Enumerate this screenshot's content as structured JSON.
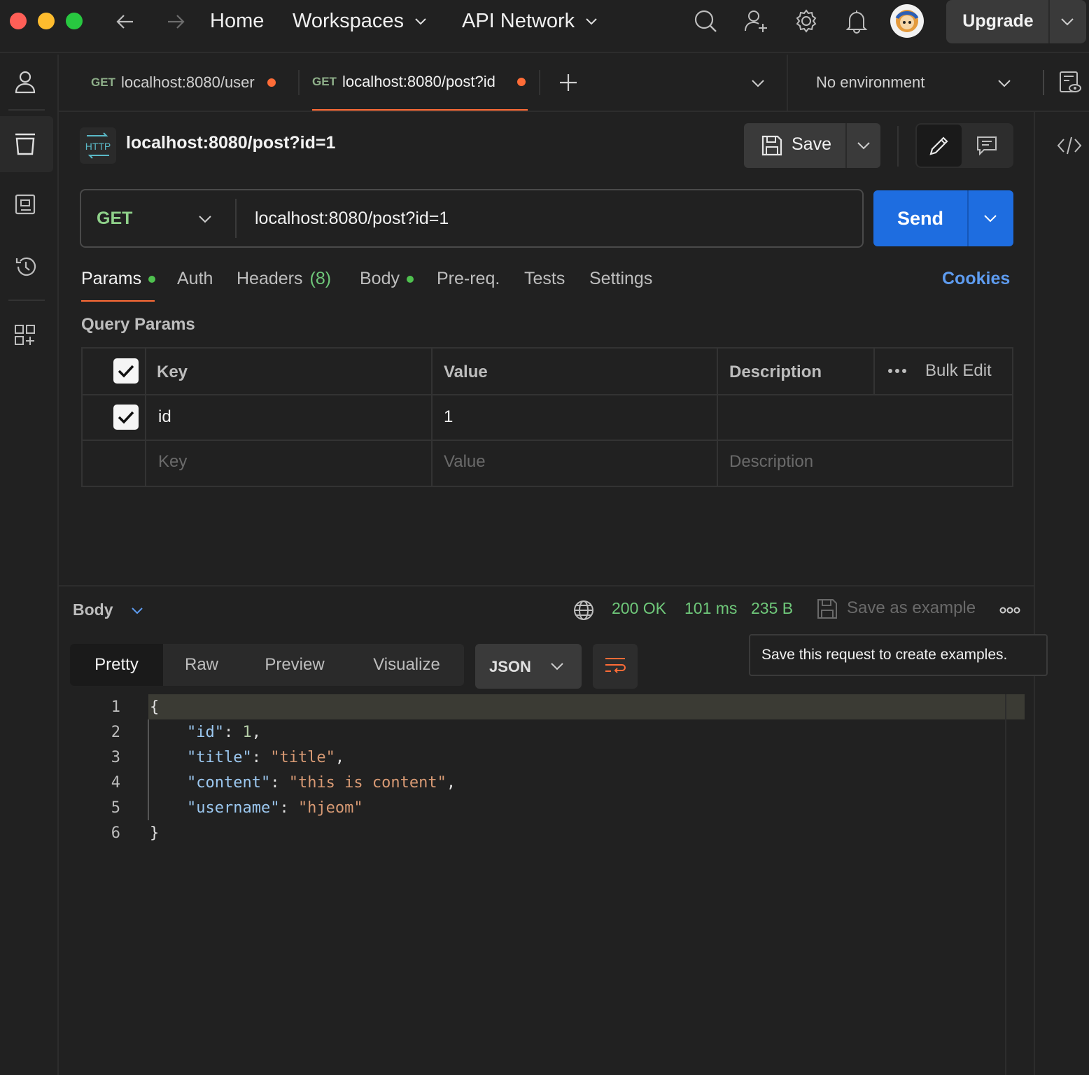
{
  "topbar": {
    "nav": {
      "home": "Home",
      "workspaces": "Workspaces",
      "api_network": "API Network"
    },
    "upgrade_label": "Upgrade",
    "icons": [
      "back-arrow-icon",
      "forward-arrow-icon",
      "search-icon",
      "invite-user-icon",
      "settings-gear-icon",
      "notification-bell-icon",
      "avatar",
      "chevron-down-icon"
    ]
  },
  "sidebar": {
    "items": [
      "user-icon",
      "collections-icon",
      "environments-icon",
      "history-icon",
      "add-apps-icon"
    ],
    "active": "collections-icon"
  },
  "tabs": {
    "items": [
      {
        "method": "GET",
        "label": "localhost:8080/user",
        "unsaved": true
      },
      {
        "method": "GET",
        "label": "localhost:8080/post?id",
        "unsaved": true,
        "active": true
      }
    ],
    "environment": "No environment"
  },
  "request": {
    "badge": "HTTP",
    "title": "localhost:8080/post?id=1",
    "save_label": "Save",
    "method": "GET",
    "url": "localhost:8080/post?id=1",
    "send_label": "Send"
  },
  "request_tabs": {
    "params": "Params",
    "auth": "Auth",
    "headers": "Headers",
    "headers_count": "(8)",
    "body": "Body",
    "prereq": "Pre-req.",
    "tests": "Tests",
    "settings": "Settings",
    "cookies": "Cookies"
  },
  "params": {
    "title": "Query Params",
    "headers": {
      "key": "Key",
      "value": "Value",
      "description": "Description",
      "bulk_edit": "Bulk Edit"
    },
    "rows": [
      {
        "checked": true,
        "key": "id",
        "value": "1",
        "description": ""
      }
    ],
    "placeholders": {
      "key": "Key",
      "value": "Value",
      "description": "Description"
    }
  },
  "response": {
    "section_label": "Body",
    "status": "200 OK",
    "time": "101 ms",
    "size": "235 B",
    "save_example": "Save as example",
    "tooltip": "Save this request to create examples.",
    "view_tabs": [
      "Pretty",
      "Raw",
      "Preview",
      "Visualize"
    ],
    "active_view": "Pretty",
    "format": "JSON",
    "line_numbers": [
      "1",
      "2",
      "3",
      "4",
      "5",
      "6"
    ],
    "json": {
      "open": "{",
      "close": "}",
      "fields": [
        {
          "key": "\"id\"",
          "value": "1",
          "type": "number",
          "comma": ","
        },
        {
          "key": "\"title\"",
          "value": "\"title\"",
          "type": "string",
          "comma": ","
        },
        {
          "key": "\"content\"",
          "value": "\"this is content\"",
          "type": "string",
          "comma": ","
        },
        {
          "key": "\"username\"",
          "value": "\"hjeom\"",
          "type": "string",
          "comma": ""
        }
      ]
    }
  },
  "colors": {
    "accent_orange": "#ff6c37",
    "send_blue": "#1e6de0",
    "status_green": "#6fc87a",
    "method_green": "#8fb08a",
    "link_blue": "#5e9cf0"
  }
}
